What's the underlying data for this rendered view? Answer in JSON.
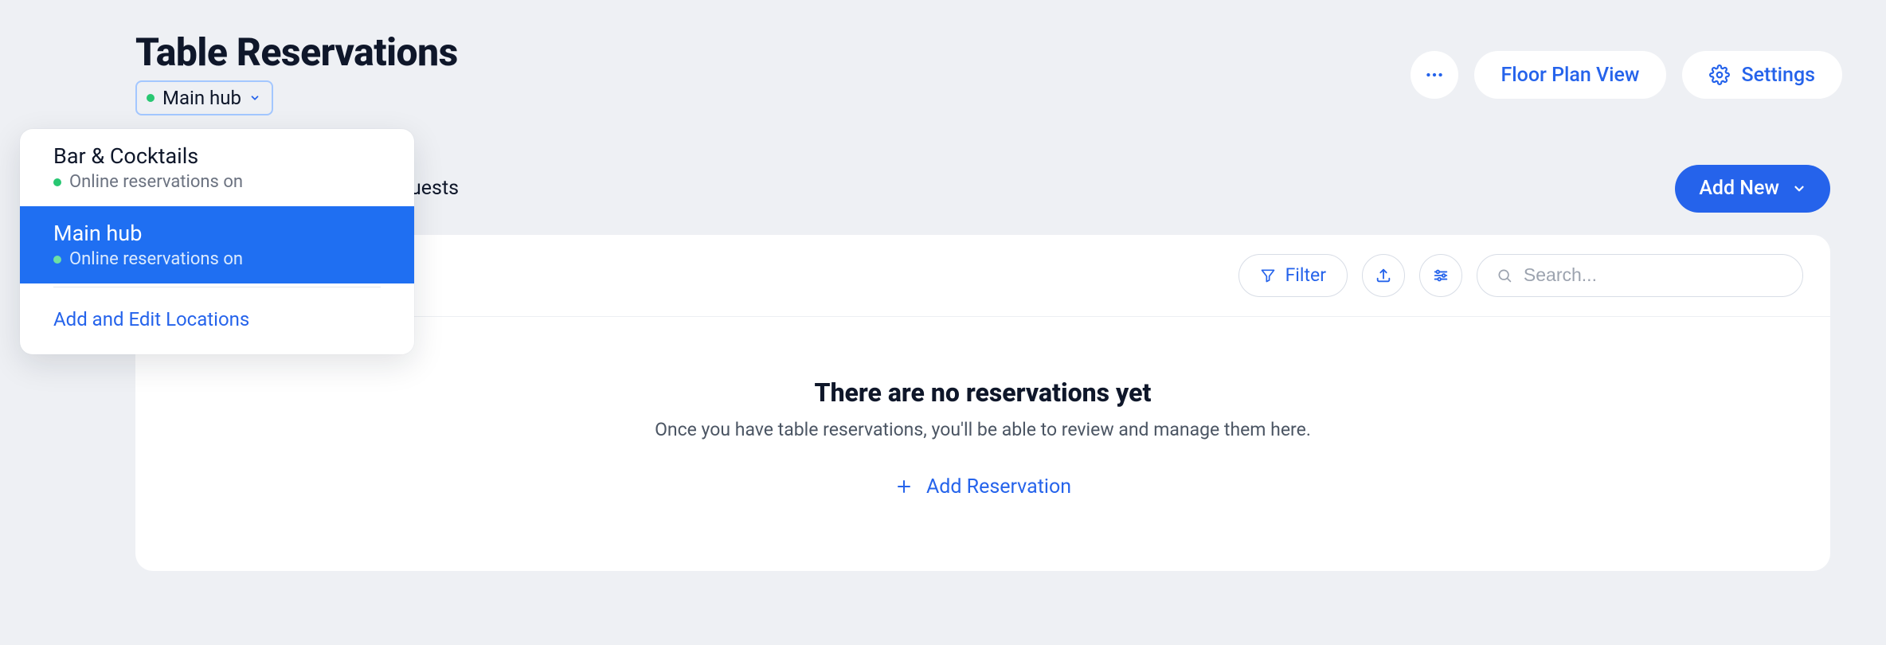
{
  "header": {
    "title": "Table Reservations",
    "location_selected": "Main hub",
    "floor_plan_label": "Floor Plan View",
    "settings_label": "Settings"
  },
  "location_dropdown": {
    "items": [
      {
        "name": "Bar & Cocktails",
        "status": "Online reservations on",
        "selected": false
      },
      {
        "name": "Main hub",
        "status": "Online reservations on",
        "selected": true
      }
    ],
    "footer_action": "Add and Edit Locations"
  },
  "tab_fragment": "uests",
  "add_new_label": "Add New",
  "toolbar": {
    "filter_label": "Filter",
    "search_placeholder": "Search..."
  },
  "empty": {
    "title": "There are no reservations yet",
    "subtitle": "Once you have table reservations, you'll be able to review and manage them here.",
    "action": "Add Reservation"
  }
}
